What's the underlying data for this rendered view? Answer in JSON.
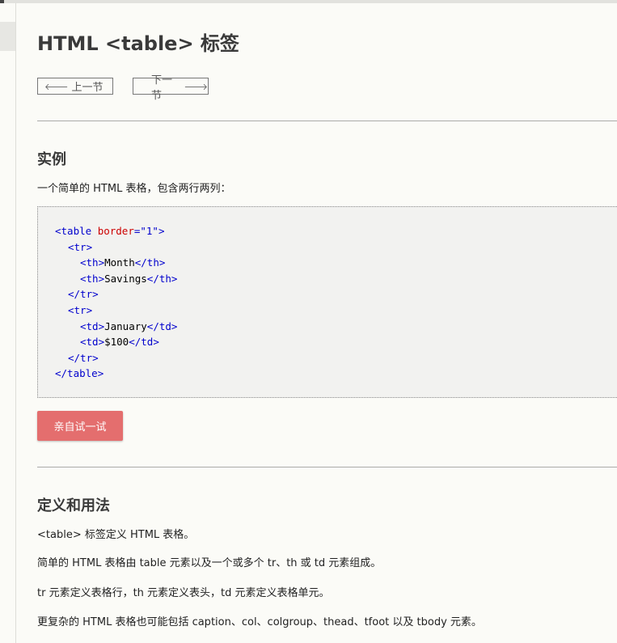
{
  "page": {
    "title": "HTML <table> 标签"
  },
  "nav": {
    "prev_label": "上一节",
    "next_label": "下一节",
    "prev_icon": "arrow-left-icon",
    "next_icon": "arrow-right-icon"
  },
  "example": {
    "heading": "实例",
    "description": "一个简单的 HTML 表格，包含两行两列：",
    "code_lines": [
      "<table border=\"1\">",
      "  <tr>",
      "    <th>Month</th>",
      "    <th>Savings</th>",
      "  </tr>",
      "  <tr>",
      "    <td>January</td>",
      "    <td>$100</td>",
      "  </tr>",
      "</table>"
    ],
    "try_button_label": "亲自试一试"
  },
  "definition": {
    "heading": "定义和用法",
    "paragraphs": [
      "<table> 标签定义 HTML 表格。",
      "简单的 HTML 表格由 table 元素以及一个或多个 tr、th 或 td 元素组成。",
      "tr 元素定义表格行，th 元素定义表头，td 元素定义表格单元。",
      "更复杂的 HTML 表格也可能包括 caption、col、colgroup、thead、tfoot 以及 tbody 元素。"
    ]
  },
  "colors": {
    "background": "#fbfbf7",
    "code_tag": "#0000cd",
    "code_attr": "#cc0000",
    "try_button": "#e46e6e"
  }
}
